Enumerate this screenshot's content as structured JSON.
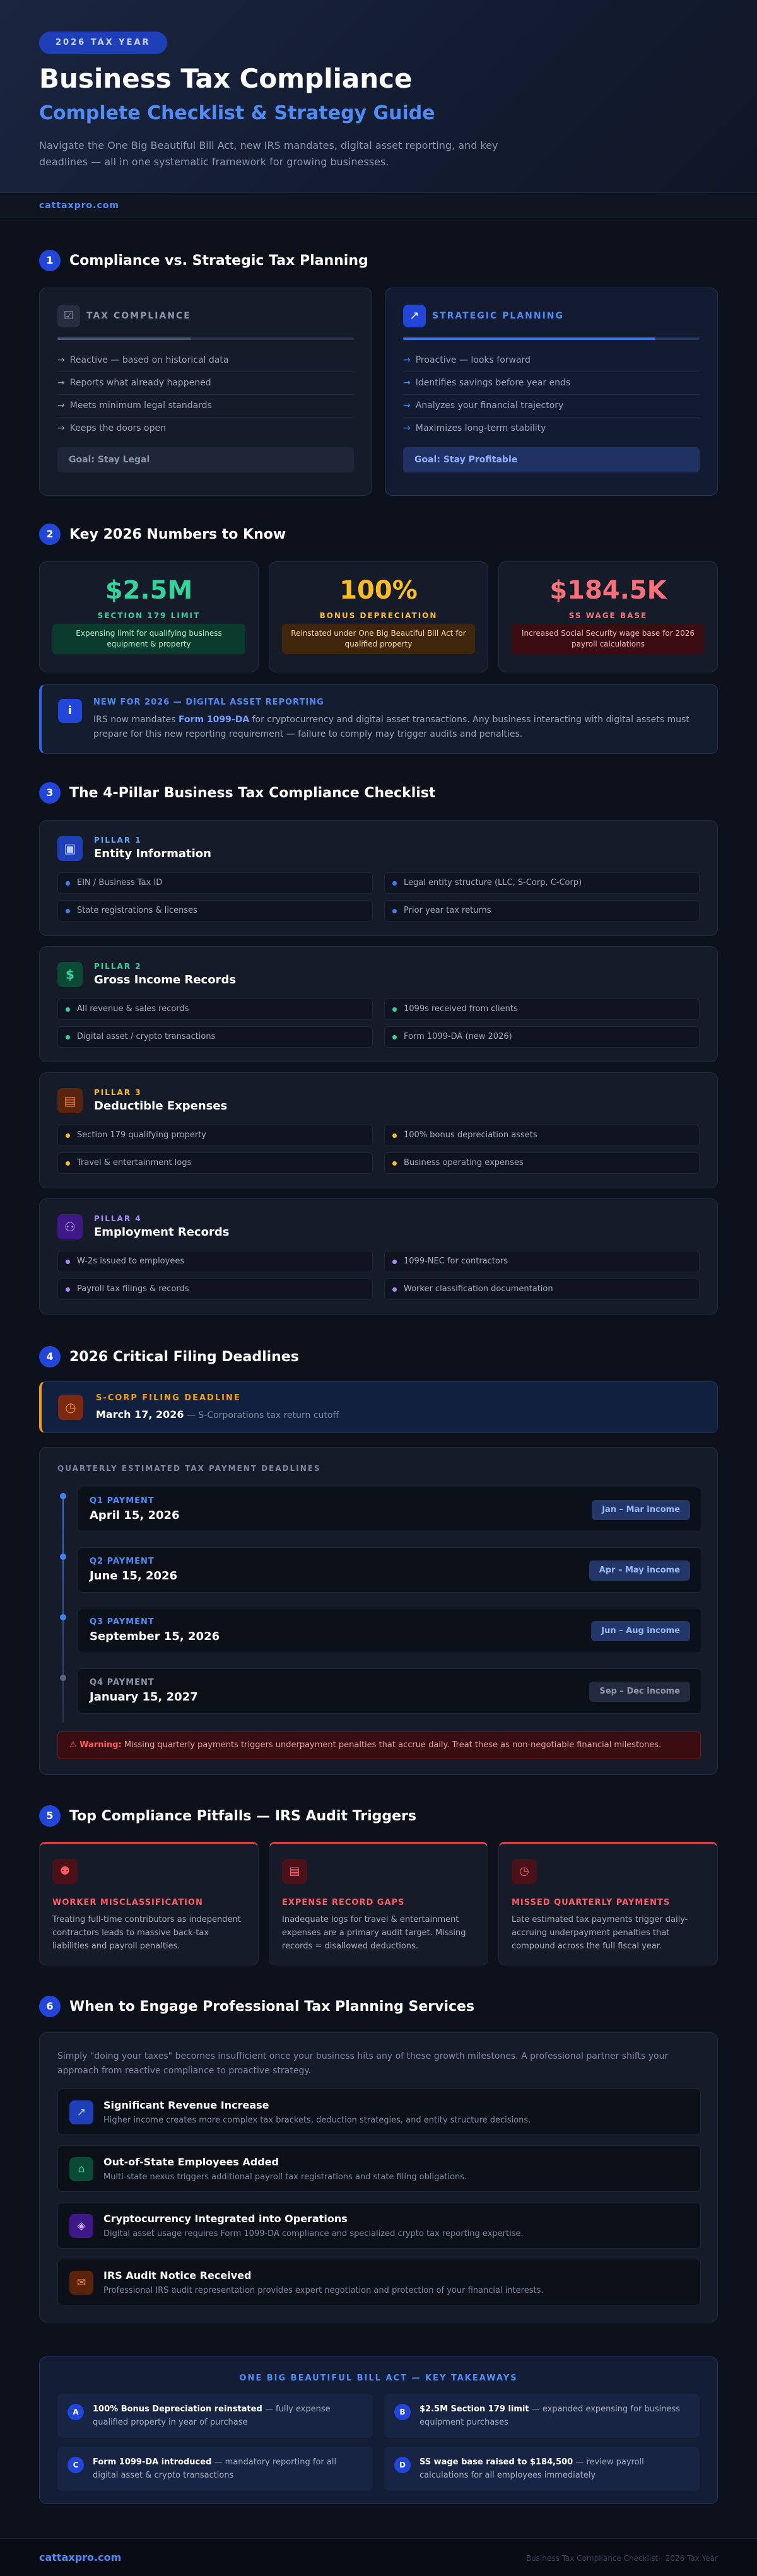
{
  "header": {
    "tag": "2026 TAX YEAR",
    "title": "Business Tax Compliance",
    "subtitle": "Complete Checklist & Strategy Guide",
    "intro": "Navigate the One Big Beautiful Bill Act, new IRS mandates, digital asset reporting, and key deadlines — all in one systematic framework for growing businesses.",
    "domain": "cattaxpro.com"
  },
  "sections": {
    "s1": {
      "num": "1",
      "title": "Compliance vs. Strategic Tax Planning"
    },
    "s2": {
      "num": "2",
      "title": "Key 2026 Numbers to Know"
    },
    "s3": {
      "num": "3",
      "title": "The 4-Pillar Business Tax Compliance Checklist"
    },
    "s4": {
      "num": "4",
      "title": "2026 Critical Filing Deadlines"
    },
    "s5": {
      "num": "5",
      "title": "Top Compliance Pitfalls — IRS Audit Triggers"
    },
    "s6": {
      "num": "6",
      "title": "When to Engage Professional Tax Planning Services"
    }
  },
  "compare": {
    "compliance": {
      "title": "TAX COMPLIANCE",
      "items": [
        "Reactive — based on historical data",
        "Reports what already happened",
        "Meets minimum legal standards",
        "Keeps the doors open"
      ],
      "goal": "Goal: Stay Legal"
    },
    "strategic": {
      "title": "STRATEGIC PLANNING",
      "items": [
        "Proactive — looks forward",
        "Identifies savings before year ends",
        "Analyzes your financial trajectory",
        "Maximizes long-term stability"
      ],
      "goal": "Goal: Stay Profitable"
    }
  },
  "stats": [
    {
      "value": "$2.5M",
      "label": "SECTION 179 LIMIT",
      "note": "Expensing limit for qualifying business equipment & property",
      "color": "#34d399"
    },
    {
      "value": "100%",
      "label": "BONUS DEPRECIATION",
      "note": "Reinstated under One Big Beautiful Bill Act for qualified property",
      "color": "#fbbf24"
    },
    {
      "value": "$184.5K",
      "label": "SS WAGE BASE",
      "note": "Increased Social Security wage base for 2026 payroll calculations",
      "color": "#f8717a"
    }
  ],
  "alert": {
    "title": "NEW FOR 2026 — DIGITAL ASSET REPORTING",
    "text_before": "IRS now mandates ",
    "text_bold": "Form 1099-DA",
    "text_after": " for cryptocurrency and digital asset transactions. Any business interacting with digital assets must prepare for this new reporting requirement — failure to comply may trigger audits and penalties."
  },
  "pillars": [
    {
      "kicker": "PILLAR 1",
      "title": "Entity Information",
      "color": "#60a5fa",
      "items": [
        "EIN / Business Tax ID",
        "Legal entity structure (LLC, S-Corp, C-Corp)",
        "State registrations & licenses",
        "Prior year tax returns"
      ]
    },
    {
      "kicker": "PILLAR 2",
      "title": "Gross Income Records",
      "color": "#34d399",
      "items": [
        "All revenue & sales records",
        "1099s received from clients",
        "Digital asset / crypto transactions",
        "Form 1099-DA (new 2026)"
      ]
    },
    {
      "kicker": "PILLAR 3",
      "title": "Deductible Expenses",
      "color": "#fbbf24",
      "items": [
        "Section 179 qualifying property",
        "100% bonus depreciation assets",
        "Travel & entertainment logs",
        "Business operating expenses"
      ]
    },
    {
      "kicker": "PILLAR 4",
      "title": "Employment Records",
      "color": "#a78bfa",
      "items": [
        "W-2s issued to employees",
        "1099-NEC for contractors",
        "Payroll tax filings & records",
        "Worker classification documentation"
      ]
    }
  ],
  "scorp": {
    "kicker": "S-CORP FILING DEADLINE",
    "date": "March 17, 2026",
    "note": " — S-Corporations tax return cutoff"
  },
  "quarterly": {
    "heading": "QUARTERLY ESTIMATED TAX PAYMENT DEADLINES",
    "rows": [
      {
        "label": "Q1 PAYMENT",
        "date": "April 15, 2026",
        "period": "Jan – Mar income"
      },
      {
        "label": "Q2 PAYMENT",
        "date": "June 15, 2026",
        "period": "Apr – May income"
      },
      {
        "label": "Q3 PAYMENT",
        "date": "September 15, 2026",
        "period": "Jun – Aug income"
      },
      {
        "label": "Q4 PAYMENT",
        "date": "January 15, 2027",
        "period": "Sep – Dec income"
      }
    ],
    "warning_bold": "⚠ Warning:",
    "warning_text": " Missing quarterly payments triggers underpayment penalties that accrue daily. Treat these as non-negotiable financial milestones."
  },
  "pitfalls": [
    {
      "title": "WORKER MISCLASSIFICATION",
      "text": "Treating full-time contributors as independent contractors leads to massive back-tax liabilities and payroll penalties."
    },
    {
      "title": "EXPENSE RECORD GAPS",
      "text": "Inadequate logs for travel & entertainment expenses are a primary audit target. Missing records = disallowed deductions."
    },
    {
      "title": "MISSED QUARTERLY PAYMENTS",
      "text": "Late estimated tax payments trigger daily-accruing underpayment penalties that compound across the full fiscal year."
    }
  ],
  "engage": {
    "intro": "Simply \"doing your taxes\" becomes insufficient once your business hits any of these growth milestones. A professional partner shifts your approach from reactive compliance to proactive strategy.",
    "rows": [
      {
        "title": "Significant Revenue Increase",
        "text": "Higher income creates more complex tax brackets, deduction strategies, and entity structure decisions."
      },
      {
        "title": "Out-of-State Employees Added",
        "text": "Multi-state nexus triggers additional payroll tax registrations and state filing obligations."
      },
      {
        "title": "Cryptocurrency Integrated into Operations",
        "text": "Digital asset usage requires Form 1099-DA compliance and specialized crypto tax reporting expertise."
      },
      {
        "title": "IRS Audit Notice Received",
        "text": "Professional IRS audit representation provides expert negotiation and protection of your financial interests."
      }
    ]
  },
  "takeaways": {
    "title": "ONE BIG BEAUTIFUL BILL ACT — KEY TAKEAWAYS",
    "items": [
      {
        "letter": "A",
        "bold": "100% Bonus Depreciation reinstated",
        "text": " — fully expense qualified property in year of purchase"
      },
      {
        "letter": "B",
        "bold": "$2.5M Section 179 limit",
        "text": " — expanded expensing for business equipment purchases"
      },
      {
        "letter": "C",
        "bold": "Form 1099-DA introduced",
        "text": " — mandatory reporting for all digital asset & crypto transactions"
      },
      {
        "letter": "D",
        "bold": "SS wage base raised to $184,500",
        "text": " — review payroll calculations for all employees immediately"
      }
    ]
  },
  "footer": {
    "left": "cattaxpro.com",
    "right": "Business Tax Compliance Checklist · 2026 Tax Year"
  }
}
